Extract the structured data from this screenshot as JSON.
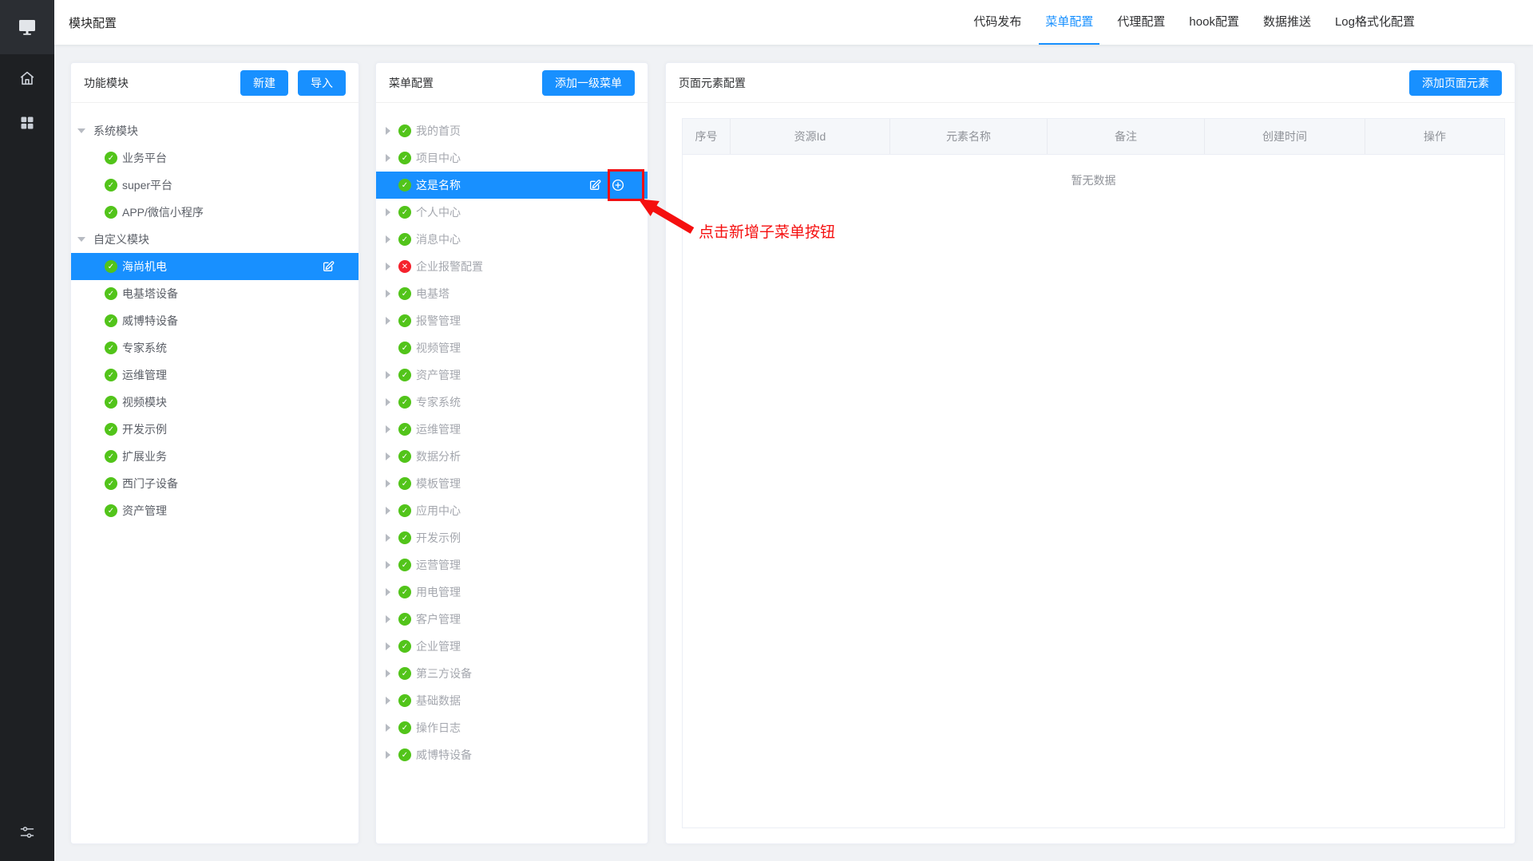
{
  "colors": {
    "accent": "#1890ff",
    "success": "#52c41a",
    "error": "#f5222d",
    "annotation": "#f50f0f"
  },
  "header": {
    "title": "模块配置",
    "tabs": [
      {
        "label": "代码发布",
        "active": false
      },
      {
        "label": "菜单配置",
        "active": true
      },
      {
        "label": "代理配置",
        "active": false
      },
      {
        "label": "hook配置",
        "active": false
      },
      {
        "label": "数据推送",
        "active": false
      },
      {
        "label": "Log格式化配置",
        "active": false
      }
    ]
  },
  "sidebar": {
    "icons": [
      "monitor-icon",
      "home-icon",
      "apps-grid-icon",
      "sliders-icon"
    ]
  },
  "modules_panel": {
    "title": "功能模块",
    "new_button": "新建",
    "import_button": "导入",
    "tree": [
      {
        "label": "系统模块",
        "expanded": true,
        "children": [
          {
            "label": "业务平台",
            "status": "success",
            "selected": false
          },
          {
            "label": "super平台",
            "status": "success",
            "selected": false
          },
          {
            "label": "APP/微信小程序",
            "status": "success",
            "selected": false
          }
        ]
      },
      {
        "label": "自定义模块",
        "expanded": true,
        "children": [
          {
            "label": "海尚机电",
            "status": "success",
            "selected": true
          },
          {
            "label": "电基塔设备",
            "status": "success",
            "selected": false
          },
          {
            "label": "威博特设备",
            "status": "success",
            "selected": false
          },
          {
            "label": "专家系统",
            "status": "success",
            "selected": false
          },
          {
            "label": "运维管理",
            "status": "success",
            "selected": false
          },
          {
            "label": "视频模块",
            "status": "success",
            "selected": false
          },
          {
            "label": "开发示例",
            "status": "success",
            "selected": false
          },
          {
            "label": "扩展业务",
            "status": "success",
            "selected": false
          },
          {
            "label": "西门子设备",
            "status": "success",
            "selected": false
          },
          {
            "label": "资产管理",
            "status": "success",
            "selected": false
          }
        ]
      }
    ]
  },
  "menu_panel": {
    "title": "菜单配置",
    "add_button": "添加一级菜单",
    "items": [
      {
        "label": "我的首页",
        "caret": true,
        "status": "success",
        "selected": false
      },
      {
        "label": "项目中心",
        "caret": true,
        "status": "success",
        "selected": false
      },
      {
        "label": "这是名称",
        "caret": false,
        "status": "success",
        "selected": true
      },
      {
        "label": "个人中心",
        "caret": true,
        "status": "success",
        "selected": false
      },
      {
        "label": "消息中心",
        "caret": true,
        "status": "success",
        "selected": false
      },
      {
        "label": "企业报警配置",
        "caret": true,
        "status": "error",
        "selected": false
      },
      {
        "label": "电基塔",
        "caret": true,
        "status": "success",
        "selected": false
      },
      {
        "label": "报警管理",
        "caret": true,
        "status": "success",
        "selected": false
      },
      {
        "label": "视频管理",
        "caret": false,
        "status": "success",
        "selected": false
      },
      {
        "label": "资产管理",
        "caret": true,
        "status": "success",
        "selected": false
      },
      {
        "label": "专家系统",
        "caret": true,
        "status": "success",
        "selected": false
      },
      {
        "label": "运维管理",
        "caret": true,
        "status": "success",
        "selected": false
      },
      {
        "label": "数据分析",
        "caret": true,
        "status": "success",
        "selected": false
      },
      {
        "label": "模板管理",
        "caret": true,
        "status": "success",
        "selected": false
      },
      {
        "label": "应用中心",
        "caret": true,
        "status": "success",
        "selected": false
      },
      {
        "label": "开发示例",
        "caret": true,
        "status": "success",
        "selected": false
      },
      {
        "label": "运营管理",
        "caret": true,
        "status": "success",
        "selected": false
      },
      {
        "label": "用电管理",
        "caret": true,
        "status": "success",
        "selected": false
      },
      {
        "label": "客户管理",
        "caret": true,
        "status": "success",
        "selected": false
      },
      {
        "label": "企业管理",
        "caret": true,
        "status": "success",
        "selected": false
      },
      {
        "label": "第三方设备",
        "caret": true,
        "status": "success",
        "selected": false
      },
      {
        "label": "基础数据",
        "caret": true,
        "status": "success",
        "selected": false
      },
      {
        "label": "操作日志",
        "caret": true,
        "status": "success",
        "selected": false
      },
      {
        "label": "威博特设备",
        "caret": true,
        "status": "success",
        "selected": false
      }
    ]
  },
  "elements_panel": {
    "title": "页面元素配置",
    "add_button": "添加页面元素",
    "table": {
      "columns": [
        "序号",
        "资源Id",
        "元素名称",
        "备注",
        "创建时间",
        "操作"
      ],
      "empty_text": "暂无数据"
    }
  },
  "annotation": {
    "text": "点击新增子菜单按钮"
  }
}
